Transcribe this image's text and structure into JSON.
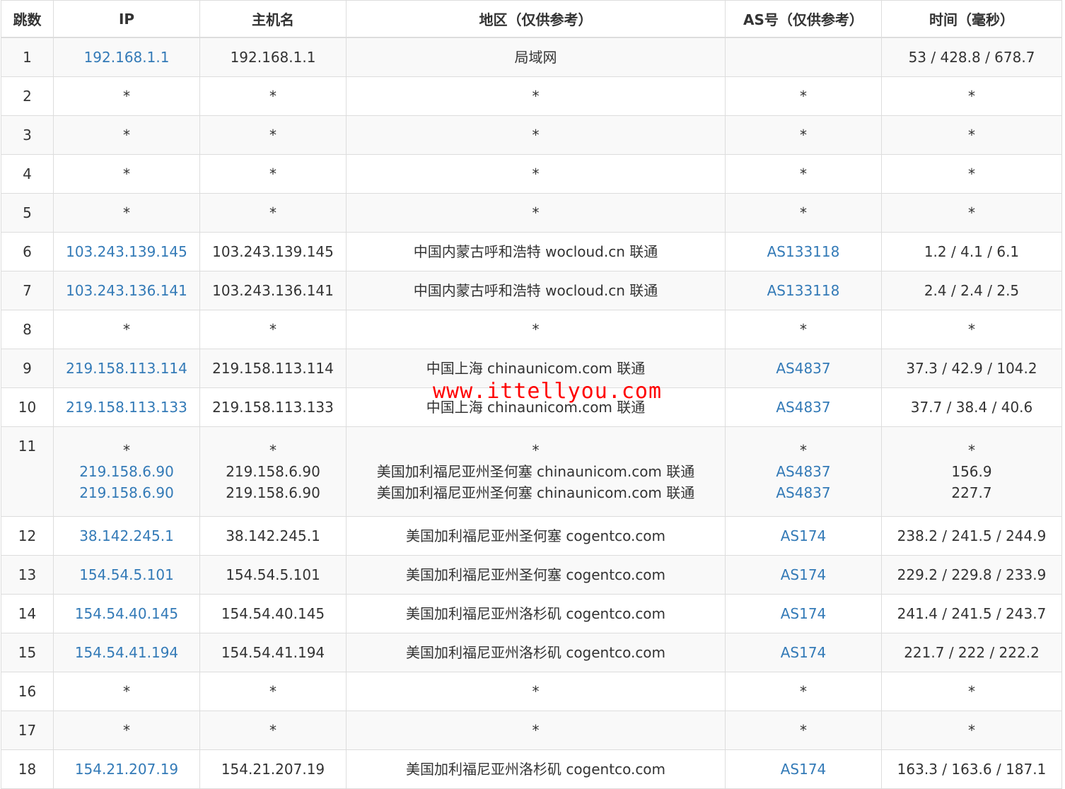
{
  "headers": {
    "hop": "跳数",
    "ip": "IP",
    "hostname": "主机名",
    "region": "地区（仅供参考）",
    "asn": "AS号（仅供参考）",
    "time": "时间（毫秒）"
  },
  "rows": [
    {
      "hop": "1",
      "ip": "192.168.1.1",
      "host": "192.168.1.1",
      "region": "局域网",
      "asn": "",
      "time": "53 / 428.8 / 678.7"
    },
    {
      "hop": "2",
      "ip": "*",
      "host": "*",
      "region": "*",
      "asn": "*",
      "time": "*"
    },
    {
      "hop": "3",
      "ip": "*",
      "host": "*",
      "region": "*",
      "asn": "*",
      "time": "*"
    },
    {
      "hop": "4",
      "ip": "*",
      "host": "*",
      "region": "*",
      "asn": "*",
      "time": "*"
    },
    {
      "hop": "5",
      "ip": "*",
      "host": "*",
      "region": "*",
      "asn": "*",
      "time": "*"
    },
    {
      "hop": "6",
      "ip": "103.243.139.145",
      "host": "103.243.139.145",
      "region": "中国内蒙古呼和浩特 wocloud.cn 联通",
      "asn": "AS133118",
      "time": "1.2 / 4.1 / 6.1"
    },
    {
      "hop": "7",
      "ip": "103.243.136.141",
      "host": "103.243.136.141",
      "region": "中国内蒙古呼和浩特 wocloud.cn 联通",
      "asn": "AS133118",
      "time": "2.4 / 2.4 / 2.5"
    },
    {
      "hop": "8",
      "ip": "*",
      "host": "*",
      "region": "*",
      "asn": "*",
      "time": "*"
    },
    {
      "hop": "9",
      "ip": "219.158.113.114",
      "host": "219.158.113.114",
      "region": "中国上海 chinaunicom.com 联通",
      "asn": "AS4837",
      "time": "37.3 / 42.9 / 104.2"
    },
    {
      "hop": "10",
      "ip": "219.158.113.133",
      "host": "219.158.113.133",
      "region": "中国上海 chinaunicom.com 联通",
      "asn": "AS4837",
      "time": "37.7 / 38.4 / 40.6"
    }
  ],
  "row11": {
    "hop": "11",
    "lines": [
      {
        "ip": "*",
        "host": "*",
        "region": "*",
        "asn": "*",
        "time": "*"
      },
      {
        "ip": "219.158.6.90",
        "host": "219.158.6.90",
        "region": "美国加利福尼亚州圣何塞 chinaunicom.com 联通",
        "asn": "AS4837",
        "time": "156.9"
      },
      {
        "ip": "219.158.6.90",
        "host": "219.158.6.90",
        "region": "美国加利福尼亚州圣何塞 chinaunicom.com 联通",
        "asn": "AS4837",
        "time": "227.7"
      }
    ]
  },
  "rows_after": [
    {
      "hop": "12",
      "ip": "38.142.245.1",
      "host": "38.142.245.1",
      "region": "美国加利福尼亚州圣何塞 cogentco.com",
      "asn": "AS174",
      "time": "238.2 / 241.5 / 244.9"
    },
    {
      "hop": "13",
      "ip": "154.54.5.101",
      "host": "154.54.5.101",
      "region": "美国加利福尼亚州圣何塞 cogentco.com",
      "asn": "AS174",
      "time": "229.2 / 229.8 / 233.9"
    },
    {
      "hop": "14",
      "ip": "154.54.40.145",
      "host": "154.54.40.145",
      "region": "美国加利福尼亚州洛杉矶 cogentco.com",
      "asn": "AS174",
      "time": "241.4 / 241.5 / 243.7"
    },
    {
      "hop": "15",
      "ip": "154.54.41.194",
      "host": "154.54.41.194",
      "region": "美国加利福尼亚州洛杉矶 cogentco.com",
      "asn": "AS174",
      "time": "221.7 / 222 / 222.2"
    },
    {
      "hop": "16",
      "ip": "*",
      "host": "*",
      "region": "*",
      "asn": "*",
      "time": "*"
    },
    {
      "hop": "17",
      "ip": "*",
      "host": "*",
      "region": "*",
      "asn": "*",
      "time": "*"
    },
    {
      "hop": "18",
      "ip": "154.21.207.19",
      "host": "154.21.207.19",
      "region": "美国加利福尼亚州洛杉矶 cogentco.com",
      "asn": "AS174",
      "time": "163.3 / 163.6 / 187.1"
    }
  ],
  "watermark": "www.ittellyou.com",
  "colors": {
    "link": "#337ab7",
    "watermark": "#ff0000",
    "stripe": "#f9f9f9",
    "border": "#dddddd"
  }
}
